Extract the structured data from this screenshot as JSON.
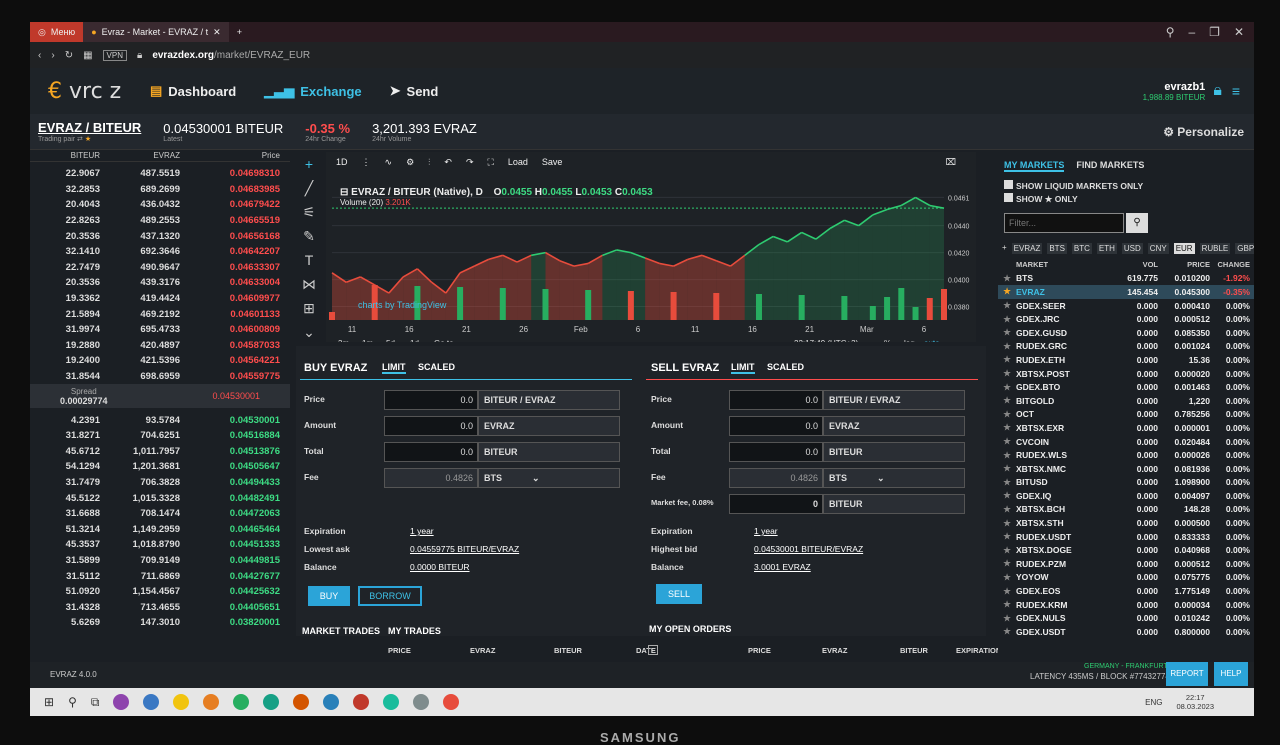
{
  "browser": {
    "menu": "Меню",
    "tab_title": "Evraz - Market - EVRAZ / t",
    "url_host": "evrazdex.org",
    "url_path": "/market/EVRAZ_EUR"
  },
  "nav": {
    "logo": "vrc z",
    "dashboard": "Dashboard",
    "exchange": "Exchange",
    "send": "Send"
  },
  "account": {
    "name": "evrazb1",
    "balance": "1,988.89 BITEUR"
  },
  "pair": {
    "name": "EVRAZ / BITEUR",
    "label": "Trading pair",
    "latest": "0.04530001 BITEUR",
    "latest_label": "Latest",
    "change": "-0.35 %",
    "change_label": "24hr Change",
    "volume": "3,201.393 EVRAZ",
    "volume_label": "24hr Volume",
    "personalize": "Personalize"
  },
  "orderbook": {
    "headers": [
      "BITEUR",
      "EVRAZ",
      "Price"
    ],
    "asks": [
      [
        "22.9067",
        "487.5519",
        "0.04698310"
      ],
      [
        "32.2853",
        "689.2699",
        "0.04683985"
      ],
      [
        "20.4043",
        "436.0432",
        "0.04679422"
      ],
      [
        "22.8263",
        "489.2553",
        "0.04665519"
      ],
      [
        "20.3536",
        "437.1320",
        "0.04656168"
      ],
      [
        "32.1410",
        "692.3646",
        "0.04642207"
      ],
      [
        "22.7479",
        "490.9647",
        "0.04633307"
      ],
      [
        "20.3536",
        "439.3176",
        "0.04633004"
      ],
      [
        "19.3362",
        "419.4424",
        "0.04609977"
      ],
      [
        "21.5894",
        "469.2192",
        "0.04601133"
      ],
      [
        "31.9974",
        "695.4733",
        "0.04600809"
      ],
      [
        "19.2880",
        "420.4897",
        "0.04587033"
      ],
      [
        "19.2400",
        "421.5396",
        "0.04564221"
      ],
      [
        "31.8544",
        "698.6959",
        "0.04559775"
      ]
    ],
    "spread_label": "Spread",
    "spread": "0.00029774",
    "last": "0.04530001",
    "bids": [
      [
        "4.2391",
        "93.5784",
        "0.04530001"
      ],
      [
        "31.8271",
        "704.6251",
        "0.04516884"
      ],
      [
        "45.6712",
        "1,011.7957",
        "0.04513876"
      ],
      [
        "54.1294",
        "1,201.3681",
        "0.04505647"
      ],
      [
        "31.7479",
        "706.3828",
        "0.04494433"
      ],
      [
        "45.5122",
        "1,015.3328",
        "0.04482491"
      ],
      [
        "31.6688",
        "708.1474",
        "0.04472063"
      ],
      [
        "51.3214",
        "1,149.2959",
        "0.04465464"
      ],
      [
        "45.3537",
        "1,018.8790",
        "0.04451333"
      ],
      [
        "31.5899",
        "709.9149",
        "0.04449815"
      ],
      [
        "31.5112",
        "711.6869",
        "0.04427677"
      ],
      [
        "51.0920",
        "1,154.4567",
        "0.04425632"
      ],
      [
        "31.4328",
        "713.4655",
        "0.04405651"
      ],
      [
        "5.6269",
        "147.3010",
        "0.03820001"
      ]
    ]
  },
  "chart_data": {
    "type": "line",
    "title": "EVRAZ / BITEUR (Native), D",
    "ohlc": {
      "O": "0.0455",
      "H": "0.0455",
      "L": "0.0453",
      "C": "0.0453"
    },
    "volume_label": "Volume (20)",
    "volume_value": "3.201K",
    "x": [
      "11",
      "16",
      "21",
      "26",
      "Feb",
      "6",
      "11",
      "16",
      "21",
      "Mar",
      "6"
    ],
    "yticks": [
      "0.0461",
      "0.0440",
      "0.0420",
      "0.0400",
      "0.0380"
    ],
    "ylim": [
      0.037,
      0.0465
    ],
    "values": [
      0.0405,
      0.0398,
      0.0402,
      0.0396,
      0.039,
      0.0402,
      0.0408,
      0.0398,
      0.039,
      0.0405,
      0.041,
      0.0415,
      0.0418,
      0.0413,
      0.0418,
      0.042,
      0.0414,
      0.041,
      0.0412,
      0.0418,
      0.0422,
      0.042,
      0.0416,
      0.0412,
      0.041,
      0.0415,
      0.0418,
      0.0414,
      0.041,
      0.0418,
      0.0426,
      0.0432,
      0.0428,
      0.0435,
      0.043,
      0.0438,
      0.0444,
      0.044,
      0.0448,
      0.0452,
      0.0455,
      0.0461,
      0.0455,
      0.0453
    ],
    "time": "22:17:49 (UTC+3)",
    "toolbar": {
      "interval": "1D",
      "load": "Load",
      "save": "Save"
    },
    "ranges": [
      "3m",
      "1m",
      "5d",
      "1d",
      "Go to..."
    ],
    "opts": [
      "%",
      "log",
      "auto"
    ],
    "watermark": "charts by TradingView"
  },
  "buy": {
    "title": "BUY EVRAZ",
    "tab_limit": "LIMIT",
    "tab_scaled": "SCALED",
    "price_l": "Price",
    "price": "0.0",
    "price_unit": "BITEUR / EVRAZ",
    "amount_l": "Amount",
    "amount": "0.0",
    "amount_unit": "EVRAZ",
    "total_l": "Total",
    "total": "0.0",
    "total_unit": "BITEUR",
    "fee_l": "Fee",
    "fee": "0.4826",
    "fee_unit": "BTS",
    "exp_l": "Expiration",
    "exp": "1 year",
    "ask_l": "Lowest ask",
    "ask": "0.04559775 BITEUR/EVRAZ",
    "bal_l": "Balance",
    "bal": "0.0000 BITEUR",
    "buy_btn": "BUY",
    "borrow_btn": "BORROW"
  },
  "sell": {
    "title": "SELL EVRAZ",
    "tab_limit": "LIMIT",
    "tab_scaled": "SCALED",
    "price_l": "Price",
    "price": "0.0",
    "price_unit": "BITEUR / EVRAZ",
    "amount_l": "Amount",
    "amount": "0.0",
    "amount_unit": "EVRAZ",
    "total_l": "Total",
    "total": "0.0",
    "total_unit": "BITEUR",
    "fee_l": "Fee",
    "fee": "0.4826",
    "fee_unit": "BTS",
    "mfee_l": "Market fee, 0.08%",
    "mfee": "0",
    "mfee_unit": "BITEUR",
    "exp_l": "Expiration",
    "exp": "1 year",
    "bid_l": "Highest bid",
    "bid": "0.04530001 BITEUR/EVRAZ",
    "bal_l": "Balance",
    "bal": "3.0001 EVRAZ",
    "sell_btn": "SELL"
  },
  "trades": {
    "tab1": "MARKET TRADES",
    "tab2": "MY TRADES",
    "tab3": "MY OPEN ORDERS",
    "h_price": "PRICE",
    "h_evraz": "EVRAZ",
    "h_biteur": "BITEUR",
    "h_date": "DATE",
    "h_exp": "EXPIRATION"
  },
  "markets": {
    "tab1": "MY MARKETS",
    "tab2": "FIND MARKETS",
    "opt1": "SHOW LIQUID MARKETS ONLY",
    "opt2": "SHOW ★ ONLY",
    "filter": "Filter...",
    "bases": [
      "EVRAZ",
      "BTS",
      "BTC",
      "ETH",
      "USD",
      "CNY",
      "EUR",
      "RUBLE",
      "GBP"
    ],
    "h_market": "MARKET",
    "h_vol": "VOL",
    "h_price": "PRICE",
    "h_change": "CHANGE",
    "rows": [
      [
        "BTS",
        "619.775",
        "0.010200",
        "-1.92%"
      ],
      [
        "EVRAZ",
        "145.454",
        "0.045300",
        "-0.35%"
      ],
      [
        "GDEX.SEER",
        "0.000",
        "0.000410",
        "0.00%"
      ],
      [
        "GDEX.JRC",
        "0.000",
        "0.000512",
        "0.00%"
      ],
      [
        "GDEX.GUSD",
        "0.000",
        "0.085350",
        "0.00%"
      ],
      [
        "RUDEX.GRC",
        "0.000",
        "0.001024",
        "0.00%"
      ],
      [
        "RUDEX.ETH",
        "0.000",
        "15.36",
        "0.00%"
      ],
      [
        "XBTSX.POST",
        "0.000",
        "0.000020",
        "0.00%"
      ],
      [
        "GDEX.BTO",
        "0.000",
        "0.001463",
        "0.00%"
      ],
      [
        "BITGOLD",
        "0.000",
        "1,220",
        "0.00%"
      ],
      [
        "OCT",
        "0.000",
        "0.785256",
        "0.00%"
      ],
      [
        "XBTSX.EXR",
        "0.000",
        "0.000001",
        "0.00%"
      ],
      [
        "CVCOIN",
        "0.000",
        "0.020484",
        "0.00%"
      ],
      [
        "RUDEX.WLS",
        "0.000",
        "0.000026",
        "0.00%"
      ],
      [
        "XBTSX.NMC",
        "0.000",
        "0.081936",
        "0.00%"
      ],
      [
        "BITUSD",
        "0.000",
        "1.098900",
        "0.00%"
      ],
      [
        "GDEX.IQ",
        "0.000",
        "0.004097",
        "0.00%"
      ],
      [
        "XBTSX.BCH",
        "0.000",
        "148.28",
        "0.00%"
      ],
      [
        "XBTSX.STH",
        "0.000",
        "0.000500",
        "0.00%"
      ],
      [
        "RUDEX.USDT",
        "0.000",
        "0.833333",
        "0.00%"
      ],
      [
        "XBTSX.DOGE",
        "0.000",
        "0.040968",
        "0.00%"
      ],
      [
        "RUDEX.PZM",
        "0.000",
        "0.000512",
        "0.00%"
      ],
      [
        "YOYOW",
        "0.000",
        "0.075775",
        "0.00%"
      ],
      [
        "GDEX.EOS",
        "0.000",
        "1.775149",
        "0.00%"
      ],
      [
        "RUDEX.KRM",
        "0.000",
        "0.000034",
        "0.00%"
      ],
      [
        "GDEX.NULS",
        "0.000",
        "0.010242",
        "0.00%"
      ],
      [
        "GDEX.USDT",
        "0.000",
        "0.800000",
        "0.00%"
      ]
    ]
  },
  "status": {
    "version": "EVRAZ 4.0.0",
    "node": "GERMANY - FRANKFURT",
    "latency": "LATENCY 435MS / BLOCK #77432774",
    "report": "REPORT",
    "help": "HELP"
  },
  "clock": {
    "time": "22:17",
    "date": "08.03.2023",
    "lang": "ENG"
  },
  "monitor": "SAMSUNG"
}
